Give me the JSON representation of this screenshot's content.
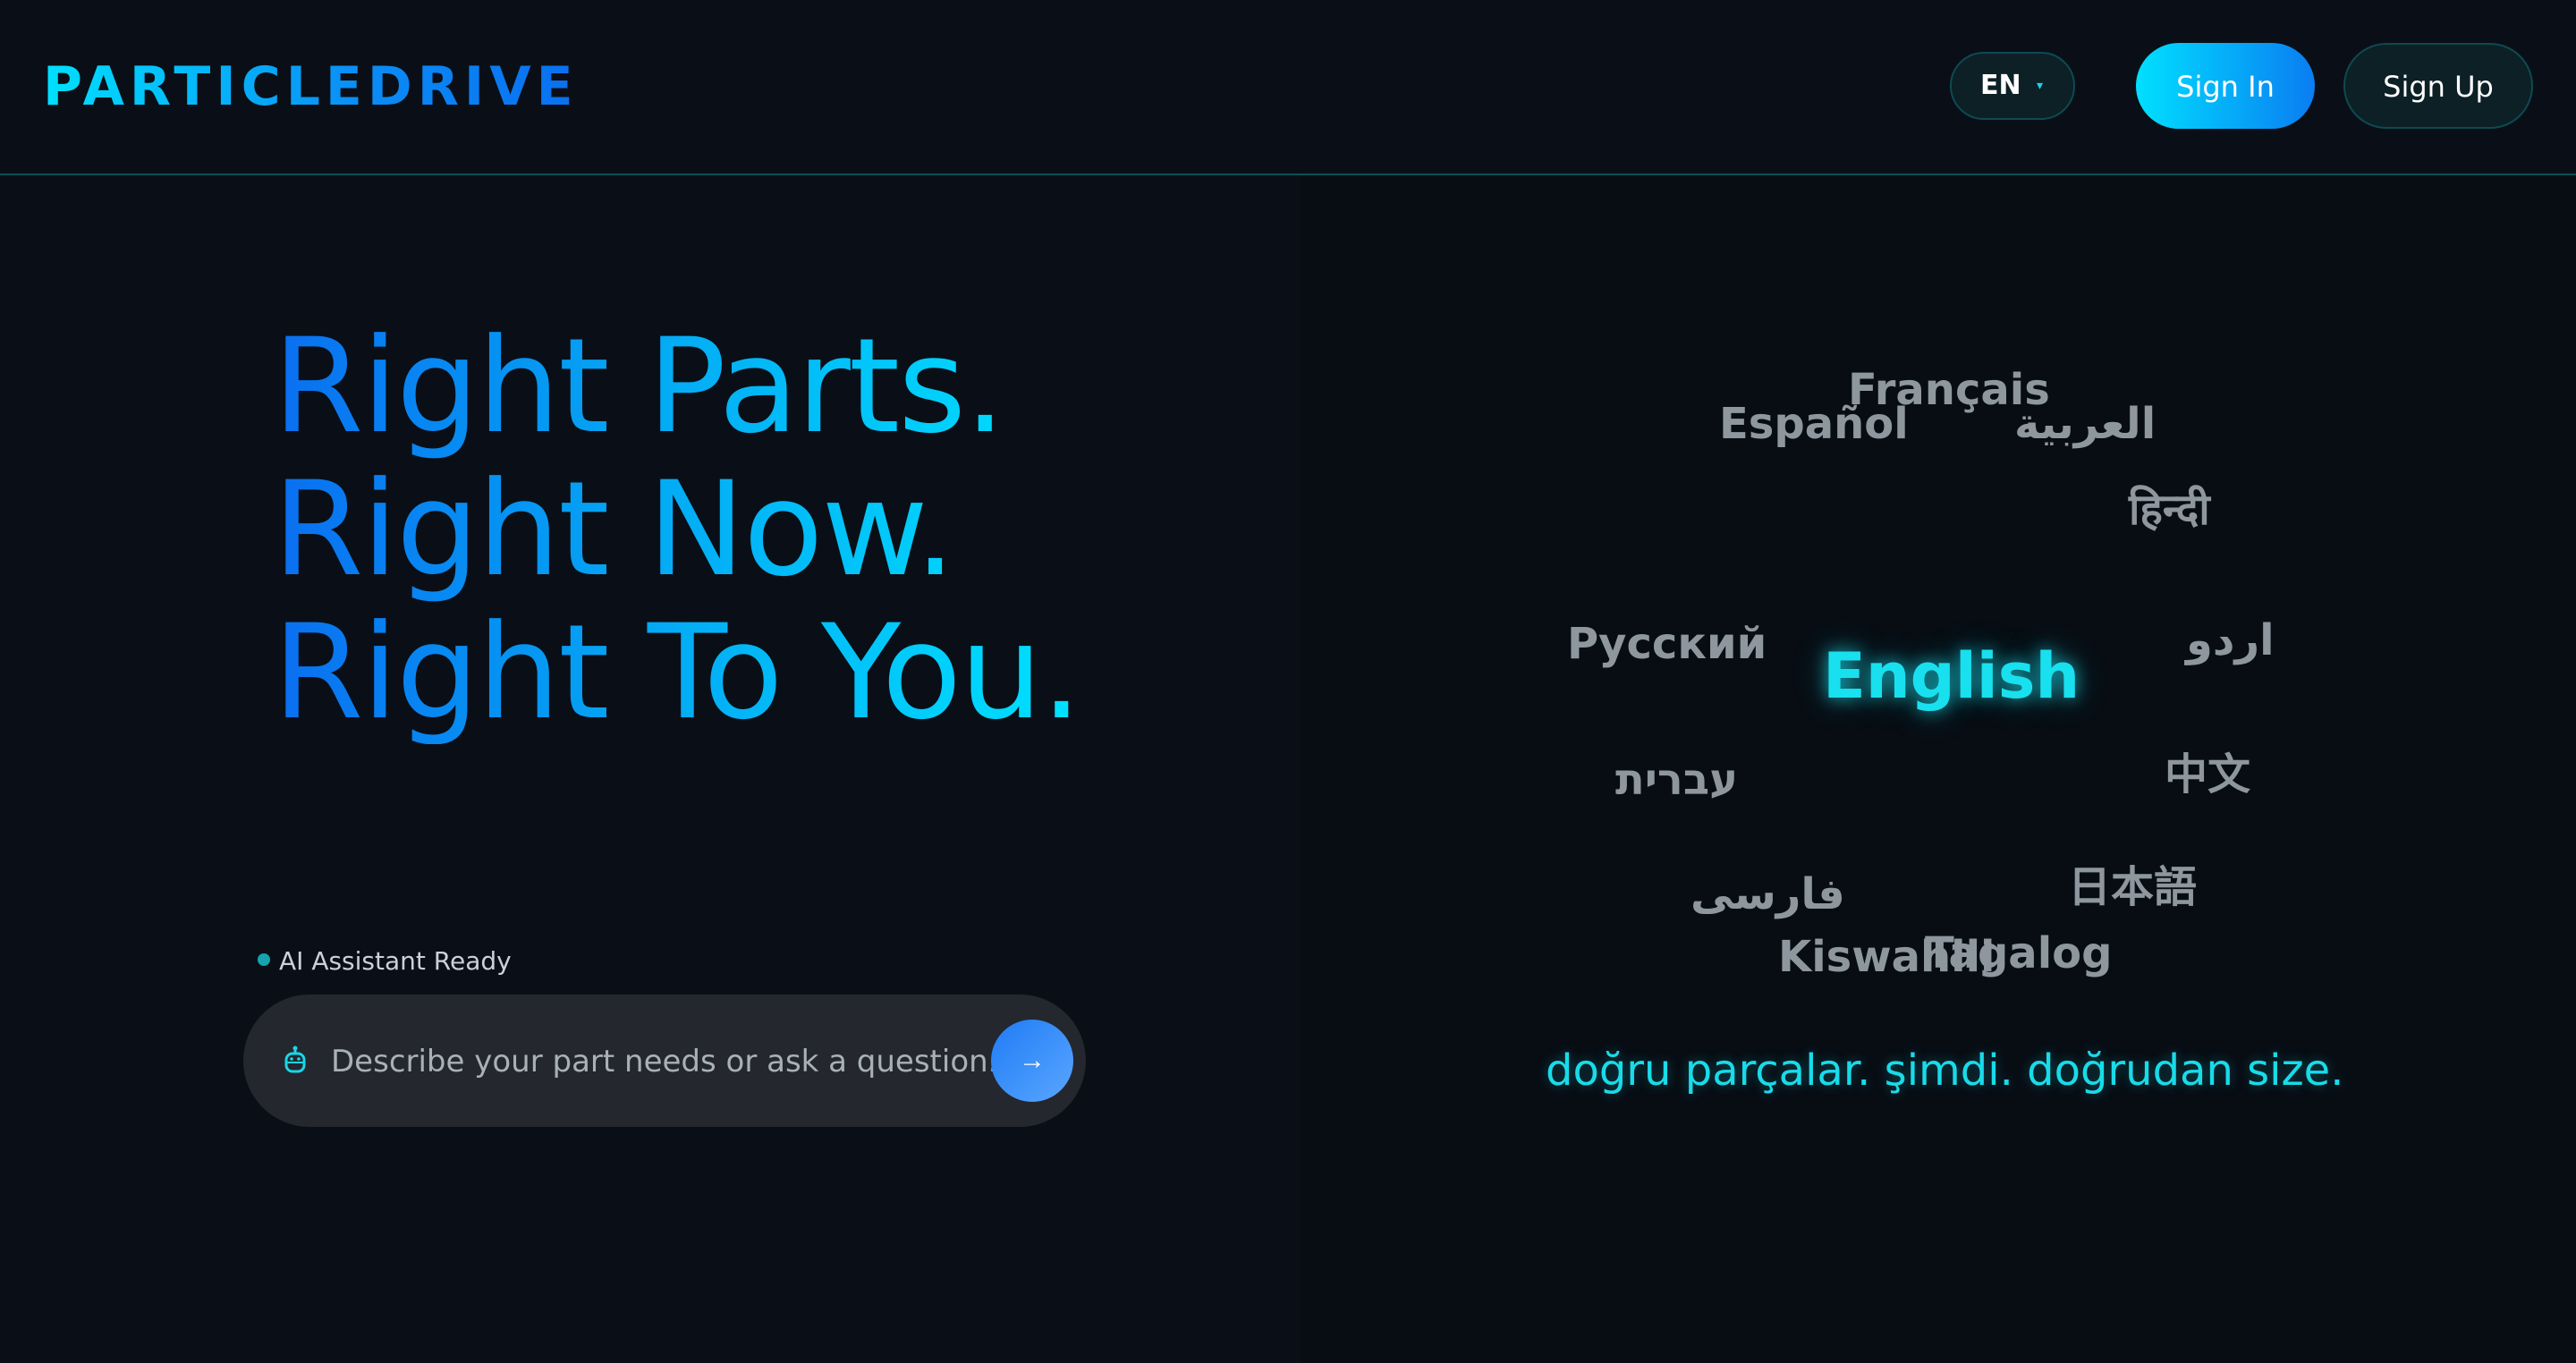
{
  "header": {
    "logo": "PARTICLEDRIVE",
    "language": {
      "selected": "EN",
      "caret": "▾"
    },
    "sign_in_label": "Sign In",
    "sign_up_label": "Sign Up"
  },
  "hero": {
    "headline": [
      "Right Parts.",
      "Right Now.",
      "Right To You."
    ]
  },
  "assistant": {
    "status": "AI Assistant Ready",
    "placeholder": "Describe your part needs or ask a question...",
    "send_label": "→",
    "icon": "robot-icon"
  },
  "language_cloud": {
    "active": "English",
    "words": [
      "Français",
      "Español",
      "العربية",
      "हिन्दी",
      "Русский",
      "اردو",
      "עברית",
      "中文",
      "فارسی",
      "日本語",
      "Kiswahili",
      "Tagalog"
    ]
  },
  "translation": "doğru parçalar. şimdi. doğrudan size.",
  "colors": {
    "background": "#0a0f17",
    "accent_cyan": "#00e0ff",
    "accent_blue": "#0a6ff0",
    "muted_word": "#8e969e"
  }
}
